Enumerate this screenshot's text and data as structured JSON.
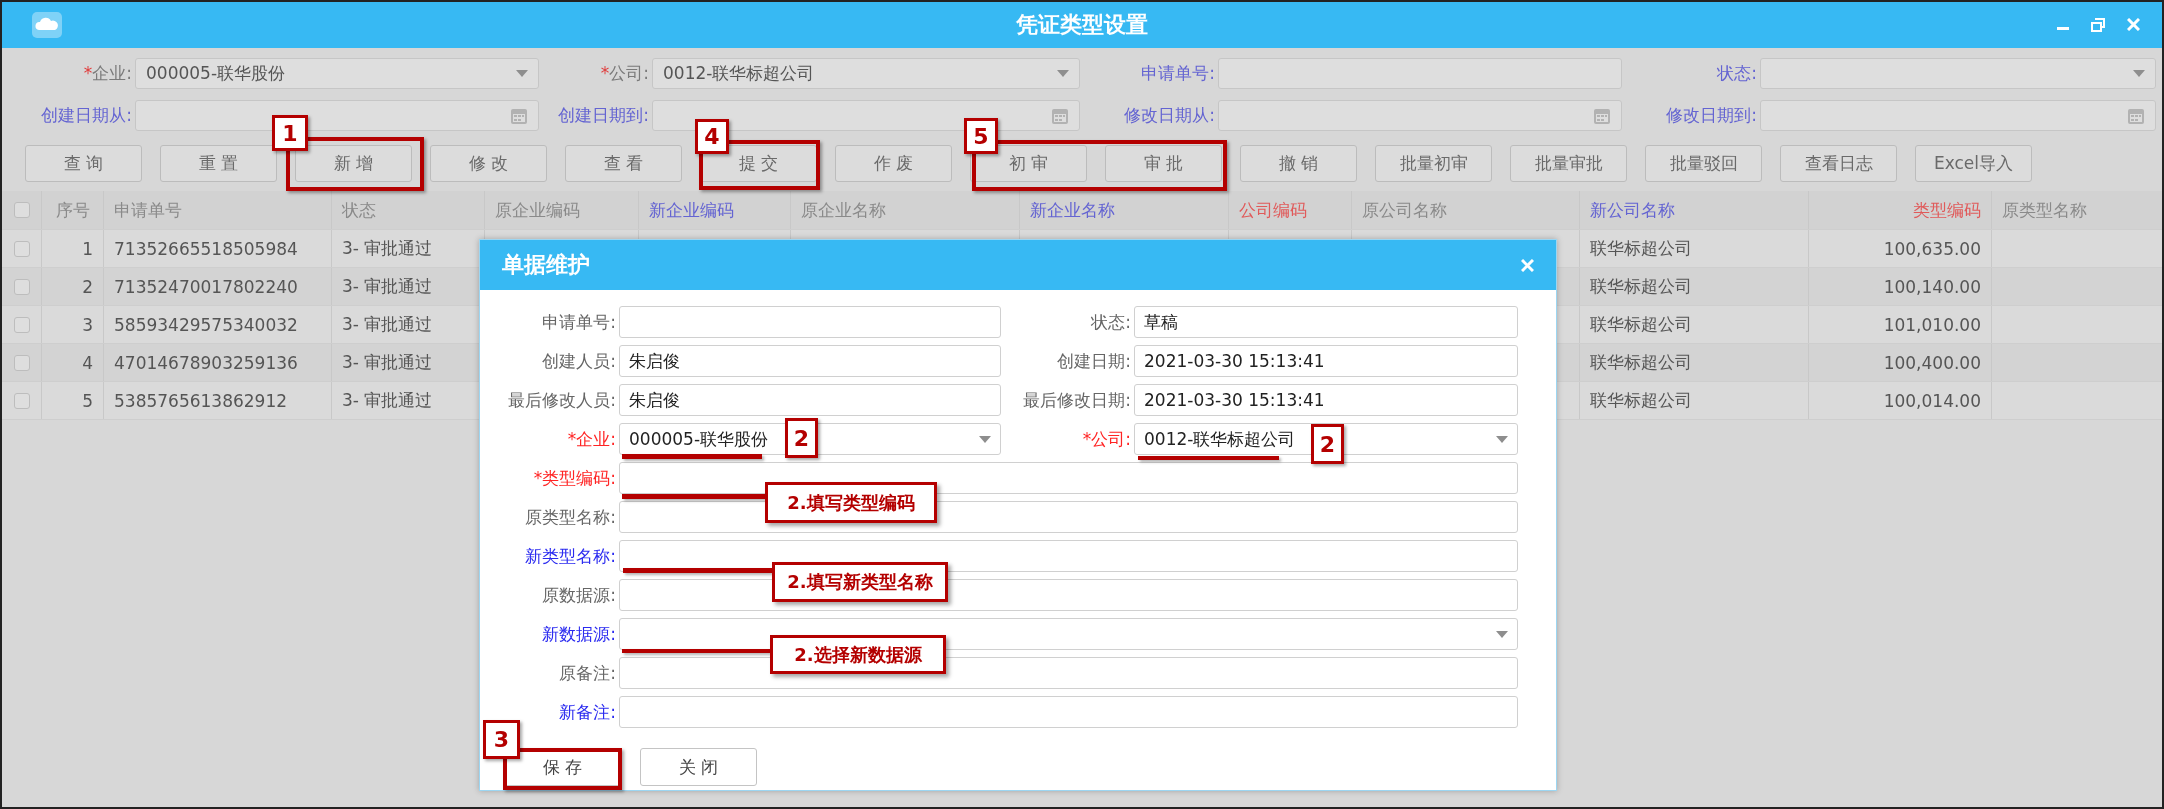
{
  "window": {
    "title": "凭证类型设置"
  },
  "filters": [
    {
      "label": "企业:",
      "required_mark": "*",
      "color": "#7a7a7a",
      "kind": "select",
      "value": "000005-联华股份"
    },
    {
      "label": "公司:",
      "required_mark": "*",
      "color": "#7a7a7a",
      "kind": "select",
      "value": "0012-联华标超公司"
    },
    {
      "label": "申请单号:",
      "color": "#6464d2",
      "kind": "text"
    },
    {
      "label": "状态:",
      "color": "#6464d2",
      "kind": "select"
    },
    {
      "label": "创建日期从:",
      "color": "#6464d2",
      "kind": "date"
    },
    {
      "label": "创建日期到:",
      "color": "#6464d2",
      "kind": "date"
    },
    {
      "label": "修改日期从:",
      "color": "#6464d2",
      "kind": "date"
    },
    {
      "label": "修改日期到:",
      "color": "#6464d2",
      "kind": "date"
    }
  ],
  "toolbar": [
    "查 询",
    "重 置",
    "新 增",
    "修 改",
    "查 看",
    "提 交",
    "作 废",
    "初 审",
    "审 批",
    "撤 销",
    "批量初审",
    "批量审批",
    "批量驳回",
    "查看日志",
    "Excel导入"
  ],
  "table": {
    "header_checked": false,
    "columns": [
      {
        "label": "序号",
        "color": "#8a8a8a"
      },
      {
        "label": "申请单号",
        "color": "#8a8a8a"
      },
      {
        "label": "状态",
        "color": "#8a8a8a"
      },
      {
        "label": "原企业编码",
        "color": "#8a8a8a"
      },
      {
        "label": "新企业编码",
        "color": "#6464d2"
      },
      {
        "label": "原企业名称",
        "color": "#8a8a8a"
      },
      {
        "label": "新企业名称",
        "color": "#6464d2"
      },
      {
        "label": "公司编码",
        "color": "#e05a5a"
      },
      {
        "label": "原公司名称",
        "color": "#8a8a8a"
      },
      {
        "label": "新公司名称",
        "color": "#6464d2"
      },
      {
        "label": "类型编码",
        "color": "#e05a5a"
      },
      {
        "label": "原类型名称",
        "color": "#8a8a8a"
      }
    ],
    "rows": [
      {
        "checked": false,
        "seq": "1",
        "app_no": "71352665518505984",
        "status": "3- 审批通过",
        "new_company_name": "联华标超公司",
        "type_code": "100,635.00"
      },
      {
        "checked": false,
        "seq": "2",
        "app_no": "71352470017802240",
        "status": "3- 审批通过",
        "new_company_name": "联华标超公司",
        "type_code": "100,140.00"
      },
      {
        "checked": false,
        "seq": "3",
        "app_no": "58593429575340032",
        "status": "3- 审批通过",
        "new_company_name": "联华标超公司",
        "type_code": "101,010.00"
      },
      {
        "checked": false,
        "seq": "4",
        "app_no": "47014678903259136",
        "status": "3- 审批通过",
        "new_company_name": "联华标超公司",
        "type_code": "100,400.00"
      },
      {
        "checked": false,
        "seq": "5",
        "app_no": "5385765613862912",
        "status": "3- 审批通过",
        "new_company_name": "联华标超公司",
        "type_code": "100,014.00"
      }
    ]
  },
  "dialog": {
    "title": "单据维护",
    "pairs": [
      [
        {
          "label": "申请单号:",
          "color": "#666666",
          "kind": "text"
        },
        {
          "label": "状态:",
          "color": "#666666",
          "kind": "text",
          "value": "草稿"
        }
      ],
      [
        {
          "label": "创建人员:",
          "color": "#666666",
          "kind": "text",
          "value": "朱启俊"
        },
        {
          "label": "创建日期:",
          "color": "#666666",
          "kind": "text",
          "value": "2021-03-30 15:13:41"
        }
      ],
      [
        {
          "label": "最后修改人员:",
          "color": "#666666",
          "kind": "text",
          "value": "朱启俊"
        },
        {
          "label": "最后修改日期:",
          "color": "#666666",
          "kind": "text",
          "value": "2021-03-30 15:13:41"
        }
      ],
      [
        {
          "label": "*企业:",
          "color": "#ff2424",
          "kind": "select",
          "value": "000005-联华股份"
        },
        {
          "label": "*公司:",
          "color": "#ff2424",
          "kind": "select",
          "value": "0012-联华标超公司"
        }
      ]
    ],
    "fields": [
      {
        "label": "*类型编码:",
        "color": "#ff2424",
        "kind": "text"
      },
      {
        "label": "原类型名称:",
        "color": "#666666",
        "kind": "text"
      },
      {
        "label": "新类型名称:",
        "color": "#2a2af0",
        "kind": "text"
      },
      {
        "label": "原数据源:",
        "color": "#666666",
        "kind": "text"
      },
      {
        "label": "新数据源:",
        "color": "#2a2af0",
        "kind": "select"
      },
      {
        "label": "原备注:",
        "color": "#666666",
        "kind": "text"
      },
      {
        "label": "新备注:",
        "color": "#2a2af0",
        "kind": "text"
      }
    ],
    "buttons": [
      "保 存",
      "关 闭"
    ]
  },
  "annotations": [
    {
      "kind": "frame"
    },
    {
      "kind": "badge",
      "text": "1"
    },
    {
      "kind": "frame"
    },
    {
      "kind": "badge",
      "text": "4"
    },
    {
      "kind": "frame"
    },
    {
      "kind": "badge",
      "text": "5"
    },
    {
      "kind": "underline"
    },
    {
      "kind": "badge",
      "text": "2"
    },
    {
      "kind": "underline"
    },
    {
      "kind": "badge",
      "text": "2"
    },
    {
      "kind": "underline"
    },
    {
      "kind": "callout",
      "text": "2.填写类型编码"
    },
    {
      "kind": "underline"
    },
    {
      "kind": "callout",
      "text": "2.填写新类型名称"
    },
    {
      "kind": "underline"
    },
    {
      "kind": "callout",
      "text": "2.选择新数据源"
    },
    {
      "kind": "frame"
    },
    {
      "kind": "badge",
      "text": "3"
    }
  ]
}
